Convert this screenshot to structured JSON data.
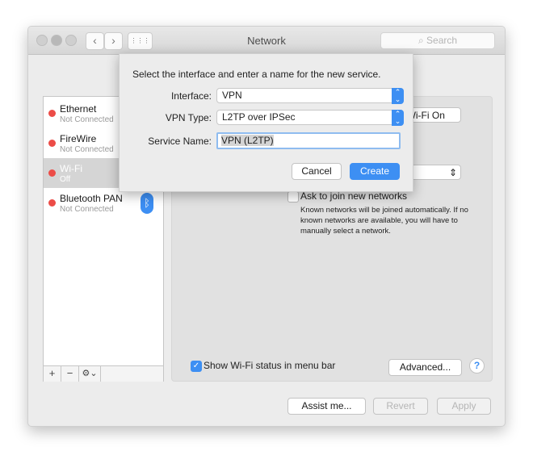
{
  "window": {
    "title": "Network",
    "search_placeholder": "Search",
    "back": "‹",
    "forward": "›",
    "grid": "⋮⋮⋮"
  },
  "services": [
    {
      "name": "Ethernet",
      "status": "Not Connected"
    },
    {
      "name": "FireWire",
      "status": "Not Connected"
    },
    {
      "name": "Wi-Fi",
      "status": "Off",
      "selected": true
    },
    {
      "name": "Bluetooth PAN",
      "status": "Not Connected"
    }
  ],
  "list_toolbar": {
    "add": "+",
    "remove": "−",
    "gear": "⚙⌄"
  },
  "panel": {
    "wifi_button": "Turn Wi-Fi On",
    "ask_label": "Ask to join new networks",
    "ask_checked": false,
    "ask_help": "Known networks will be joined automatically. If no known networks are available, you will have to manually select a network.",
    "show_status": "Show Wi-Fi status in menu bar",
    "show_checked": true,
    "advanced": "Advanced...",
    "help": "?"
  },
  "footer": {
    "assist": "Assist me...",
    "revert": "Revert",
    "apply": "Apply"
  },
  "sheet": {
    "prompt": "Select the interface and enter a name for the new service.",
    "interface_label": "Interface:",
    "interface_value": "VPN",
    "vpn_type_label": "VPN Type:",
    "vpn_type_value": "L2TP over IPSec",
    "service_name_label": "Service Name:",
    "service_name_value": "VPN (L2TP)",
    "cancel": "Cancel",
    "create": "Create"
  },
  "colors": {
    "accent": "#3d8ff3",
    "status_red": "#ec4c47"
  }
}
